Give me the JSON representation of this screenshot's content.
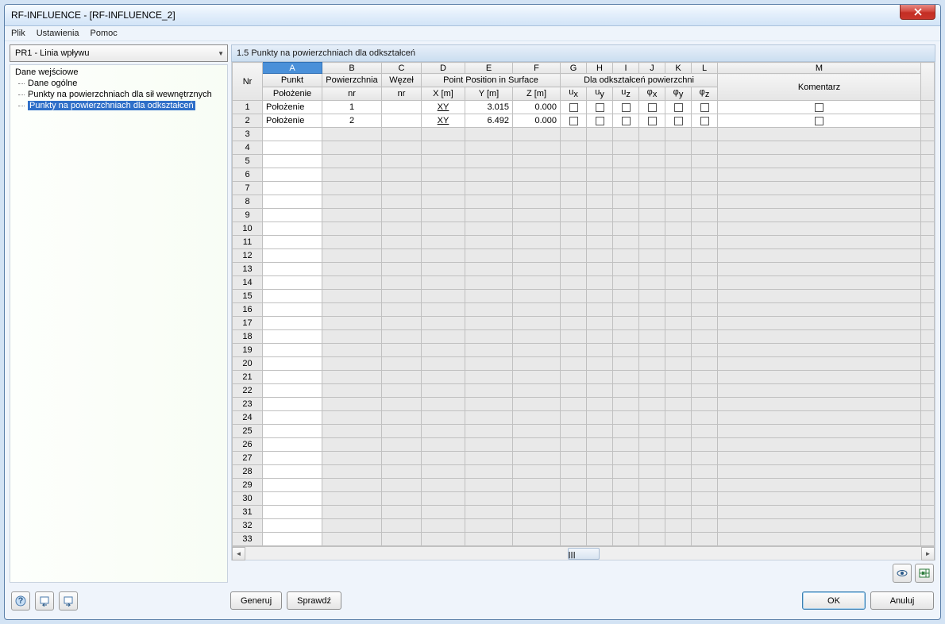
{
  "window": {
    "title": "RF-INFLUENCE - [RF-INFLUENCE_2]"
  },
  "menu": {
    "file": "Plik",
    "settings": "Ustawienia",
    "help": "Pomoc"
  },
  "combo": {
    "value": "PR1 - Linia wpływu"
  },
  "tree": {
    "root": "Dane wejściowe",
    "children": [
      {
        "label": "Dane ogólne",
        "selected": false
      },
      {
        "label": "Punkty na powierzchniach dla sił wewnętrznych",
        "selected": false
      },
      {
        "label": "Punkty na powierzchniach dla odkształceń",
        "selected": true
      }
    ]
  },
  "panel": {
    "title": "1.5 Punkty na powierzchniach dla odkształceń"
  },
  "columns": {
    "letters": [
      "A",
      "B",
      "C",
      "D",
      "E",
      "F",
      "G",
      "H",
      "I",
      "J",
      "K",
      "L",
      "M"
    ],
    "group1": "Punkt",
    "group2_surface": "Powierzchnia",
    "group2_node": "Węzeł",
    "group3": "Point Position in Surface",
    "group4": "Dla odkształceń powierzchni",
    "nr": "Nr",
    "polozenie": "Położenie",
    "nr2": "nr",
    "nr3": "nr",
    "x": "X [m]",
    "y": "Y [m]",
    "z": "Z [m]",
    "ux": "uₓ",
    "uy": "uᵧ",
    "uz": "u_z",
    "phix": "φₓ",
    "phiy": "φᵧ",
    "phiz": "φ_z",
    "comment": "Komentarz"
  },
  "rows": [
    {
      "nr": 1,
      "polozenie": "Położenie",
      "surf": "1",
      "node": "",
      "plane": "XY",
      "x": "3.015",
      "y": "0.000",
      "ux": false,
      "uy": false,
      "uz": false,
      "phix": false,
      "phiy": false,
      "phiz": false,
      "comment_cb": false
    },
    {
      "nr": 2,
      "polozenie": "Położenie",
      "surf": "2",
      "node": "",
      "plane": "XY",
      "x": "6.492",
      "y": "0.000",
      "ux": false,
      "uy": false,
      "uz": false,
      "phix": false,
      "phiy": false,
      "phiz": false,
      "comment_cb": false
    }
  ],
  "emptyRowsStart": 3,
  "emptyRowsEnd": 33,
  "buttons": {
    "generate": "Generuj",
    "check": "Sprawdź",
    "ok": "OK",
    "cancel": "Anuluj"
  },
  "icons": {
    "help": "?",
    "eye": "eye",
    "excel": "excel"
  }
}
